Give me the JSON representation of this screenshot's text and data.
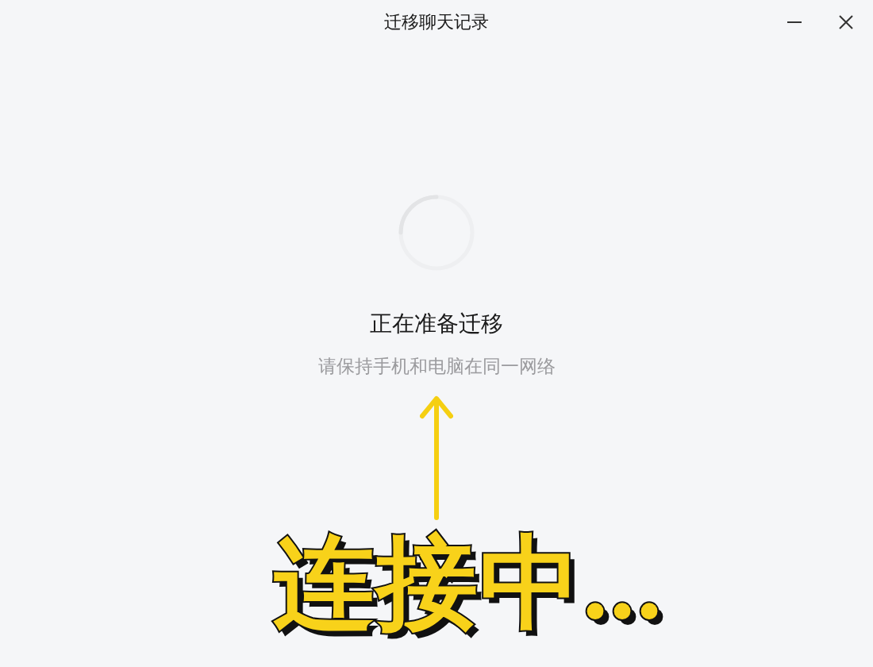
{
  "window": {
    "title": "迁移聊天记录"
  },
  "status": {
    "heading": "正在准备迁移",
    "hint": "请保持手机和电脑在同一网络"
  },
  "annotation": {
    "caption": "连接中..."
  }
}
